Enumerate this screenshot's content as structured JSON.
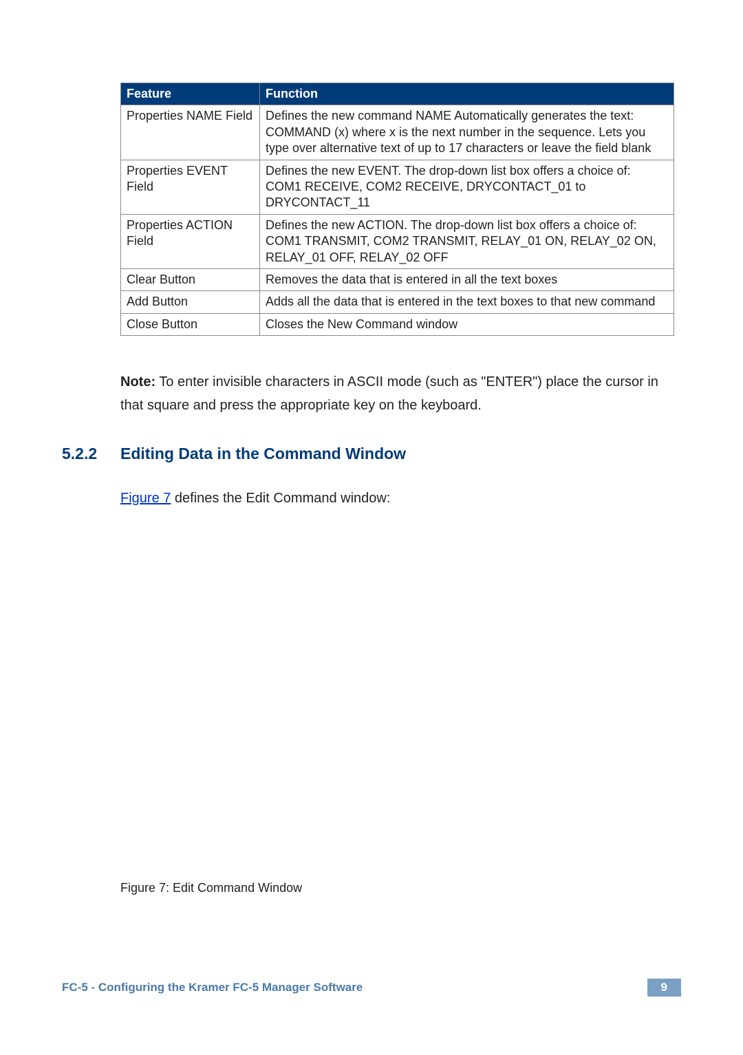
{
  "table": {
    "headers": {
      "feature": "Feature",
      "function": "Function"
    },
    "rows": [
      {
        "feature": "Properties NAME Field",
        "function": "Defines the new command NAME\nAutomatically generates the text: COMMAND (x) where x is the next number in the sequence. Lets you type over alternative text of up to 17 characters or leave the field blank"
      },
      {
        "feature": "Properties EVENT Field",
        "function": "Defines the new EVENT. The drop-down list box offers a choice of: COM1 RECEIVE, COM2 RECEIVE, DRYCONTACT_01 to DRYCONTACT_11"
      },
      {
        "feature": "Properties ACTION Field",
        "function": "Defines the new ACTION. The drop-down list box offers a choice of: COM1 TRANSMIT, COM2 TRANSMIT, RELAY_01 ON, RELAY_02 ON, RELAY_01 OFF, RELAY_02 OFF"
      },
      {
        "feature": "Clear Button",
        "function": "Removes the data that is entered in all the text boxes"
      },
      {
        "feature": "Add Button",
        "function": "Adds all the data that is entered in the text boxes to that new command"
      },
      {
        "feature": "Close Button",
        "function": "Closes the New Command window"
      }
    ]
  },
  "note": {
    "label": "Note:",
    "text": " To enter invisible characters in ASCII mode (such as \"ENTER\") place the cursor in that square and press the appropriate key on the keyboard."
  },
  "section": {
    "number": "5.2.2",
    "title": "Editing Data in the Command Window"
  },
  "body": {
    "figure_link": "Figure 7",
    "after_link": " defines the Edit Command window:"
  },
  "figure_caption": "Figure 7: Edit Command Window",
  "footer": {
    "title": "FC-5 - Configuring the Kramer FC-5 Manager Software",
    "page": "9"
  }
}
